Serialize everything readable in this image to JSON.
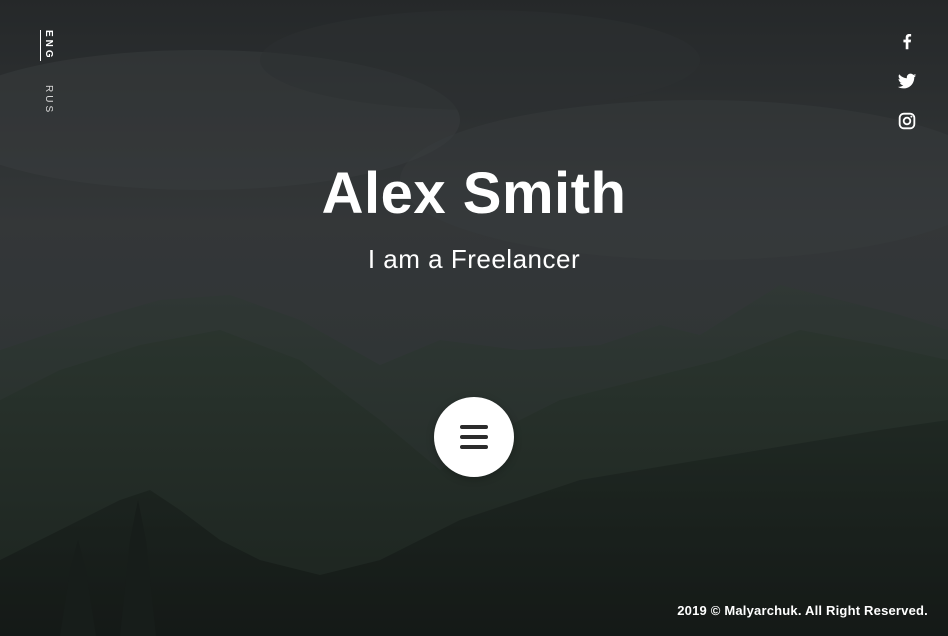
{
  "languages": {
    "active": "ENG",
    "inactive": "RUS"
  },
  "social": [
    {
      "name": "facebook-icon"
    },
    {
      "name": "twitter-icon"
    },
    {
      "name": "instagram-icon"
    }
  ],
  "hero": {
    "title": "Alex Smith",
    "subtitle_prefix": "I am a ",
    "subtitle_role": "Freelancer"
  },
  "menu_button": {
    "icon": "hamburger-menu-icon"
  },
  "footer": {
    "copyright": "2019 © Malyarchuk. All Right Reserved."
  },
  "colors": {
    "text": "#ffffff",
    "button_bg": "#ffffff",
    "button_icon": "#2b2b2b"
  }
}
